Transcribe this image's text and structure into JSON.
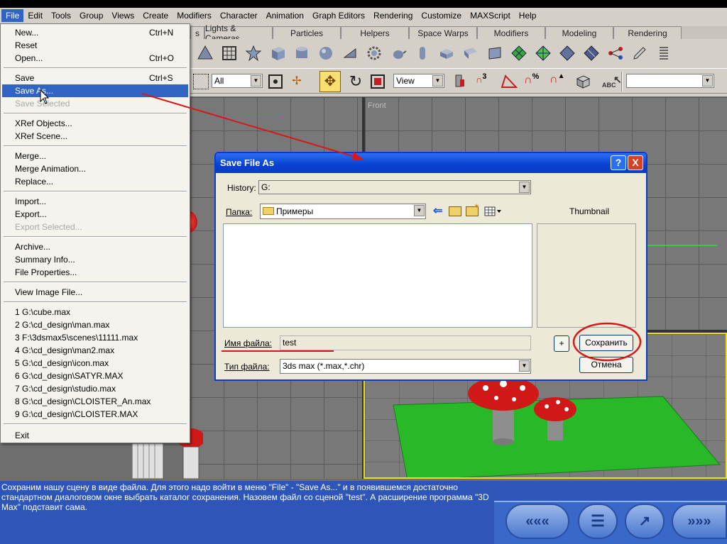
{
  "menubar": {
    "items": [
      "File",
      "Edit",
      "Tools",
      "Group",
      "Views",
      "Create",
      "Modifiers",
      "Character",
      "Animation",
      "Graph Editors",
      "Rendering",
      "Customize",
      "MAXScript",
      "Help"
    ]
  },
  "command_tabs": [
    "s",
    "Lights & Cameras",
    "Particles",
    "Helpers",
    "Space Warps",
    "Modifiers",
    "Modeling",
    "Rendering"
  ],
  "toolbar": {
    "selection_filter": "All",
    "coord_system": "View",
    "named_selection": ""
  },
  "viewports": {
    "front_label": "Front"
  },
  "file_menu": {
    "items": [
      {
        "label": "New...",
        "shortcut": "Ctrl+N"
      },
      {
        "label": "Reset",
        "shortcut": ""
      },
      {
        "label": "Open...",
        "shortcut": "Ctrl+O"
      },
      {
        "label": "Save",
        "shortcut": "Ctrl+S"
      },
      {
        "label": "Save As...",
        "shortcut": ""
      },
      {
        "label": "Save Selected",
        "shortcut": ""
      },
      {
        "label": "XRef Objects...",
        "shortcut": ""
      },
      {
        "label": "XRef Scene...",
        "shortcut": ""
      },
      {
        "label": "Merge...",
        "shortcut": ""
      },
      {
        "label": "Merge Animation...",
        "shortcut": ""
      },
      {
        "label": "Replace...",
        "shortcut": ""
      },
      {
        "label": "Import...",
        "shortcut": ""
      },
      {
        "label": "Export...",
        "shortcut": ""
      },
      {
        "label": "Export Selected...",
        "shortcut": ""
      },
      {
        "label": "Archive...",
        "shortcut": ""
      },
      {
        "label": "Summary Info...",
        "shortcut": ""
      },
      {
        "label": "File Properties...",
        "shortcut": ""
      },
      {
        "label": "View Image File...",
        "shortcut": ""
      },
      {
        "label": "1 G:\\cube.max",
        "shortcut": ""
      },
      {
        "label": "2 G:\\cd_design\\man.max",
        "shortcut": ""
      },
      {
        "label": "3 F:\\3dsmax5\\scenes\\11111.max",
        "shortcut": ""
      },
      {
        "label": "4 G:\\cd_design\\man2.max",
        "shortcut": ""
      },
      {
        "label": "5 G:\\cd_design\\icon.max",
        "shortcut": ""
      },
      {
        "label": "6 G:\\cd_design\\SATYR.MAX",
        "shortcut": ""
      },
      {
        "label": "7 G:\\cd_design\\studio.max",
        "shortcut": ""
      },
      {
        "label": "8 G:\\cd_design\\CLOISTER_An.max",
        "shortcut": ""
      },
      {
        "label": "9 G:\\cd_design\\CLOISTER.MAX",
        "shortcut": ""
      },
      {
        "label": "Exit",
        "shortcut": ""
      }
    ]
  },
  "dialog": {
    "title": "Save File As",
    "history_label": "History:",
    "history_value": "G:",
    "folder_label": "Папка:",
    "folder_value": "Примеры",
    "thumbnail_label": "Thumbnail",
    "filename_label": "Имя файла:",
    "filename_value": "test",
    "filetype_label": "Тип файла:",
    "filetype_value": "3ds max (*.max,*.chr)",
    "plus_label": "+",
    "save_label": "Сохранить",
    "cancel_label": "Отмена",
    "help_label": "?",
    "close_label": "X"
  },
  "status_text": "Сохраним нашу сцену в виде файла. Для этого надо войти в меню \"File\" - \"Save As...\" и в появившемся достаточно стандартном диалоговом окне выбрать каталог сохранения. Назовем файл со сценой \"test\". А расширение программа \"3D Max\" подставит сама.",
  "colors": {
    "menu_highlight": "#3163c5",
    "title_bar": "#0a3cc8",
    "status_bg": "#2d56b8",
    "annotation_red": "#d81818"
  }
}
